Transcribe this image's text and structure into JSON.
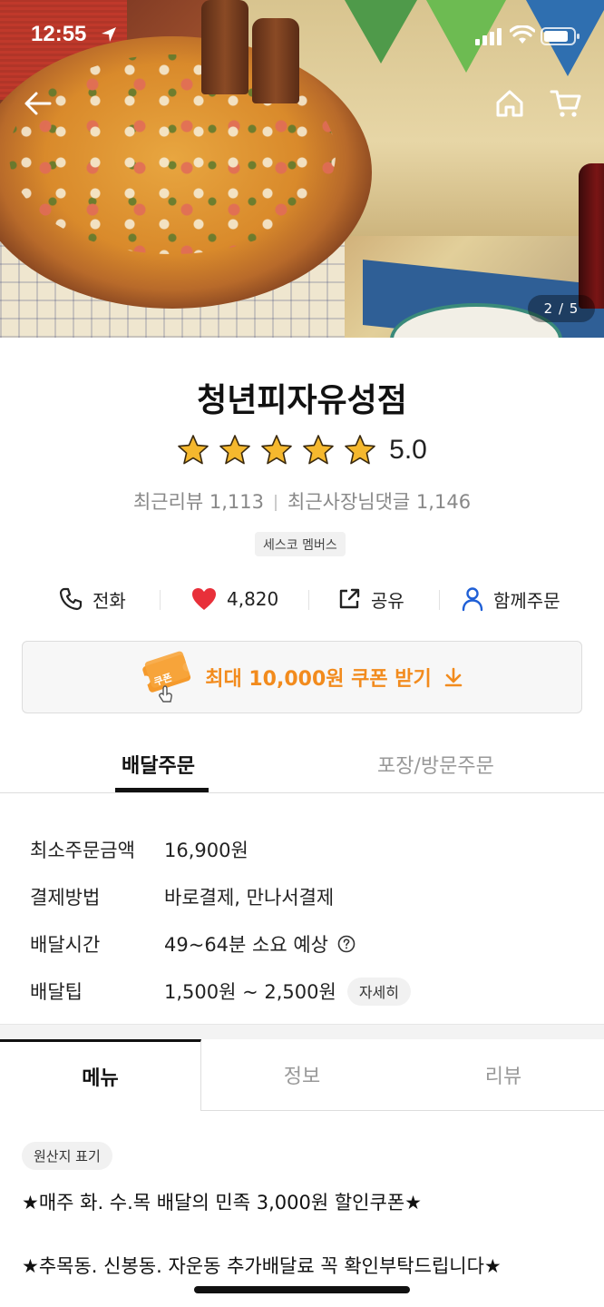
{
  "status_bar": {
    "time": "12:55"
  },
  "hero": {
    "pager": "2 / 5"
  },
  "store": {
    "name": "청년피자유성점",
    "rating": "5.0",
    "recent_reviews": "최근리뷰 1,113",
    "recent_owner_replies": "최근사장님댓글 1,146",
    "badge": "세스코 멤버스"
  },
  "actions": {
    "call": "전화",
    "likes": "4,820",
    "share": "공유",
    "group_order": "함께주문"
  },
  "coupon": {
    "label": "최대 10,000원 쿠폰 받기",
    "icon_text": "쿠폰"
  },
  "order_tabs": {
    "delivery": "배달주문",
    "pickup": "포장/방문주문"
  },
  "order_info": {
    "min_order_label": "최소주문금액",
    "min_order_value": "16,900원",
    "payment_label": "결제방법",
    "payment_value": "바로결제, 만나서결제",
    "time_label": "배달시간",
    "time_value": "49~64분 소요 예상",
    "tip_label": "배달팁",
    "tip_value": "1,500원 ~ 2,500원",
    "tip_detail": "자세히"
  },
  "content_tabs": {
    "menu": "메뉴",
    "info": "정보",
    "review": "리뷰"
  },
  "menu_section": {
    "origin_chip": "원산지 표기",
    "notice_1": "★매주 화. 수.목 배달의 민족 3,000원 할인쿠폰★",
    "notice_2": "★추목동. 신봉동. 자운동 추가배달료  꼭 확인부탁드립니다★"
  },
  "colors": {
    "accent": "#f28b1d",
    "heart": "#e8303a",
    "star": "#f5b82e"
  }
}
